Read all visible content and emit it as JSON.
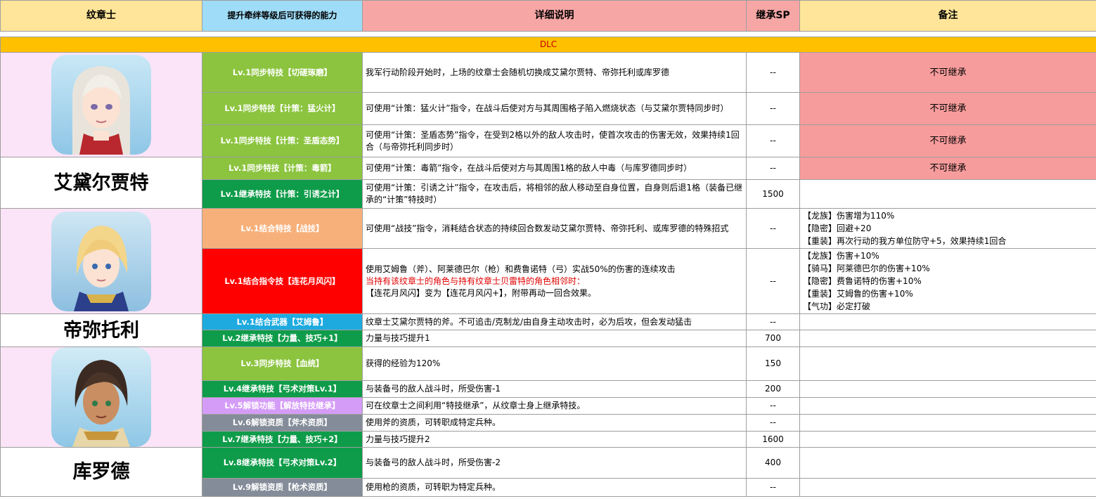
{
  "header": {
    "name": "纹章士",
    "ability": "提升牵绊等级后可获得的能力",
    "desc": "详细说明",
    "sp": "继承SP",
    "note": "备注"
  },
  "dlc_label": "DLC",
  "characters": [
    {
      "name": "艾黛尔贾特",
      "portrait_icon": "edelgard-portrait-icon"
    },
    {
      "name": "帝弥托利",
      "portrait_icon": "dimitri-portrait-icon"
    },
    {
      "name": "库罗德",
      "portrait_icon": "claude-portrait-icon"
    }
  ],
  "rows": [
    {
      "ability": "Lv.1同步特技【切磋琢磨】",
      "desc": "我军行动阶段开始时，上场的纹章士会随机切换成艾黛尔贾特、帝弥托利或库罗德",
      "sp": "--",
      "note": "不可继承",
      "color": "#8cc43f"
    },
    {
      "ability": "Lv.1同步特技【计策：猛火计】",
      "desc": "可使用“计策：猛火计”指令，在战斗后使对方与其周围格子陷入燃烧状态（与艾黛尔贾特同步时）",
      "sp": "--",
      "note": "不可继承",
      "color": "#8cc43f"
    },
    {
      "ability": "Lv.1同步特技【计策：圣盾态势】",
      "desc": "可使用“计策：圣盾态势”指令，在受到2格以外的敌人攻击时，使首次攻击的伤害无效，效果持续1回合（与帝弥托利同步时）",
      "sp": "--",
      "note": "不可继承",
      "color": "#8cc43f"
    },
    {
      "ability": "Lv.1同步特技【计策：毒箭】",
      "desc": "可使用“计策：毒箭”指令，在战斗后使对方与其周围1格的敌人中毒（与库罗德同步时）",
      "sp": "--",
      "note": "不可继承",
      "color": "#8cc43f"
    },
    {
      "ability": "Lv.1继承特技【计策：引诱之计】",
      "desc": "可使用“计策：引诱之计”指令，在攻击后，将相邻的敌人移动至自身位置，自身则后退1格（装备已继承的“计策”特技时）",
      "sp": "1500",
      "note": "",
      "color": "#0f9c4a"
    },
    {
      "ability": "Lv.1结合特技【战技】",
      "desc": "可使用“战技”指令，消耗结合状态的持续回合数发动艾黛尔贾特、帝弥托利、或库罗德的特殊招式",
      "sp": "--",
      "note_lines": [
        "【龙族】伤害增为110%",
        "【隐密】回避+20",
        "【重装】再次行动的我方单位防守+5，效果持续1回合"
      ],
      "color": "#f8b07a"
    },
    {
      "ability": "Lv.1结合指令技【连花月风闪】",
      "desc_lines": [
        "使用艾姆鲁（斧）、阿莱德巴尔（枪）和费鲁诺特（弓）实战50%的伤害的连续攻击",
        "当持有该纹章士的角色与持有纹章士贝雷特的角色相邻时：",
        "【连花月风闪】变为【连花月风闪+】，附带再动一回合效果。"
      ],
      "sp": "--",
      "note_lines": [
        "【龙族】伤害+10%",
        "【骑马】阿莱德巴尔的伤害+10%",
        "【隐密】费鲁诺特的伤害+10%",
        "【重装】艾姆鲁的伤害+10%",
        "【气功】必定打破"
      ],
      "color": "#ff0000"
    },
    {
      "ability": "Lv.1结合武器【艾姆鲁】",
      "desc": "纹章士艾黛尔贾特的斧。不可追击/克制龙/由自身主动攻击时，必为后攻，但会发动猛击",
      "sp": "--",
      "note": "",
      "color": "#1eaadf"
    },
    {
      "ability": "Lv.2继承特技【力量、技巧+1】",
      "desc": "力量与技巧提升1",
      "sp": "700",
      "note": "",
      "color": "#0f9c4a"
    },
    {
      "ability": "Lv.3同步特技【血统】",
      "desc": "获得的经验为120%",
      "sp": "150",
      "note": "",
      "color": "#8cc43f"
    },
    {
      "ability": "Lv.4继承特技【弓术对策Lv.1】",
      "desc": "与装备弓的敌人战斗时，所受伤害-1",
      "sp": "200",
      "note": "",
      "color": "#0f9c4a"
    },
    {
      "ability": "Lv.5解锁功能【解放特技继承】",
      "desc": "可在纹章士之间利用“特技继承”，从纹章士身上继承特技。",
      "sp": "--",
      "note": "",
      "color": "#d49cf7"
    },
    {
      "ability": "Lv.6解锁资质【斧术资质】",
      "desc": "使用斧的资质，可转职成特定兵种。",
      "sp": "--",
      "note": "",
      "color": "#858c99"
    },
    {
      "ability": "Lv.7继承特技【力量、技巧+2】",
      "desc": "力量与技巧提升2",
      "sp": "1600",
      "note": "",
      "color": "#0f9c4a"
    },
    {
      "ability": "Lv.8继承特技【弓术对策Lv.2】",
      "desc": "与装备弓的敌人战斗时，所受伤害-2",
      "sp": "400",
      "note": "",
      "color": "#0f9c4a"
    },
    {
      "ability": "Lv.9解锁资质【枪术资质】",
      "desc": "使用枪的资质，可转职为特定兵种。",
      "sp": "--",
      "note": "",
      "color": "#858c99"
    }
  ]
}
